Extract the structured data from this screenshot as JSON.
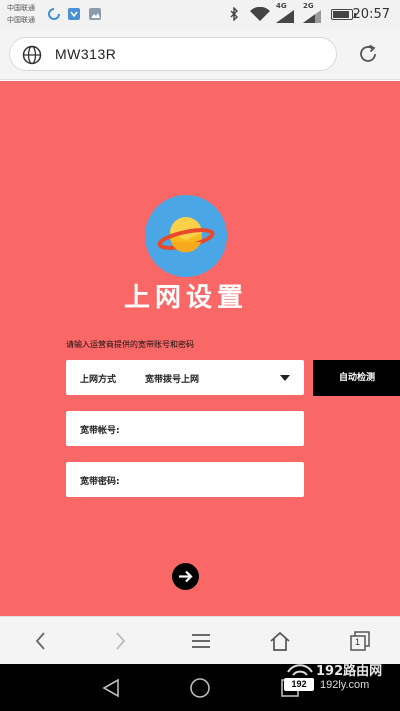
{
  "status_bar": {
    "carrier_1": "中国联通",
    "carrier_2": "中国联通",
    "net_1": "4G",
    "net_2": "2G",
    "time": "20:57",
    "battery_level": 0.8,
    "icons": [
      "sync-icon",
      "app-icon",
      "gallery-icon",
      "bluetooth-icon",
      "wifi-icon",
      "signal-icon",
      "battery-icon"
    ]
  },
  "address_bar": {
    "url": "MW313R",
    "icons": [
      "globe-icon",
      "reload-icon"
    ]
  },
  "page": {
    "background": "#f96867",
    "title": "上网设置",
    "hint": "请输入运营商提供的宽带账号和密码",
    "connection_type": {
      "label": "上网方式",
      "value": "宽带拨号上网"
    },
    "detect_button": "自动检测",
    "account_field": {
      "label": "宽带帐号:",
      "value": ""
    },
    "password_field": {
      "label": "宽带密码:",
      "value": ""
    },
    "next_icon": "arrow-right-icon"
  },
  "browser_toolbar": {
    "icons": [
      "back-icon",
      "forward-icon",
      "menu-icon",
      "home-icon",
      "tabs-icon"
    ],
    "tab_count": "1"
  },
  "watermark": {
    "site_name": "192路由网",
    "badge": "192",
    "url": "192ly.com"
  }
}
